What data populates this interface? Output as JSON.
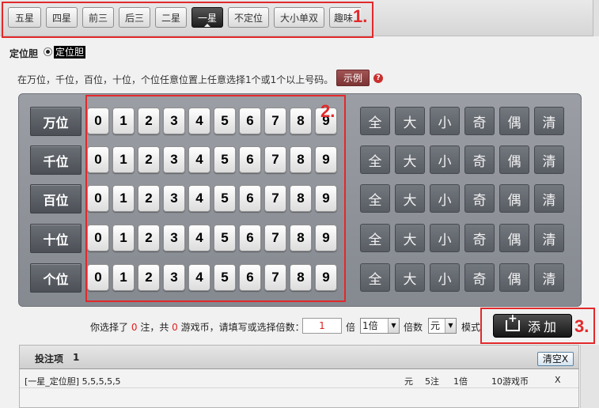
{
  "tabs": [
    {
      "label": "五星",
      "active": false
    },
    {
      "label": "四星",
      "active": false
    },
    {
      "label": "前三",
      "active": false
    },
    {
      "label": "后三",
      "active": false
    },
    {
      "label": "二星",
      "active": false
    },
    {
      "label": "一星",
      "active": true
    },
    {
      "label": "不定位",
      "active": false
    },
    {
      "label": "大小单双",
      "active": false
    },
    {
      "label": "趣味",
      "active": false
    }
  ],
  "method": {
    "group_label": "定位胆",
    "selected_option": "定位胆"
  },
  "instruction": {
    "text": "在万位，千位，百位，十位，个位任意位置上任意选择1个或1个以上号码。",
    "example_label": "示例",
    "help_glyph": "?"
  },
  "positions": [
    "万位",
    "千位",
    "百位",
    "十位",
    "个位"
  ],
  "digits": [
    "0",
    "1",
    "2",
    "3",
    "4",
    "5",
    "6",
    "7",
    "8",
    "9"
  ],
  "quick_picks": [
    "全",
    "大",
    "小",
    "奇",
    "偶",
    "清"
  ],
  "annotations": [
    "1.",
    "2.",
    "3."
  ],
  "summary": {
    "prefix": "你选择了",
    "bet_count": "0",
    "bets_unit": "注，共",
    "coin_count": "0",
    "coin_text": "游戏币，请填写或选择倍数：",
    "multiplier_value": "1",
    "multiplier_unit": "倍",
    "multiplier_select": "1倍",
    "multiplier_label": "倍数",
    "mode_select": "元",
    "mode_label": "模式",
    "add_label": "添加"
  },
  "bet_list": {
    "title": "投注项",
    "count": "1",
    "clear_label": "清空X",
    "rows": [
      {
        "content": "[一星_定位胆] 5,5,5,5,5",
        "mode": "元",
        "bets": "5注",
        "multiplier": "1倍",
        "amount": "10游戏币",
        "remove": "X"
      }
    ]
  },
  "colors": {
    "annotation_red": "#e2292b",
    "active_tab": "#1e1e1e",
    "panel_bg": "#8f9399",
    "number_highlight": "#e02020",
    "example_button": "#8a3c3c"
  }
}
